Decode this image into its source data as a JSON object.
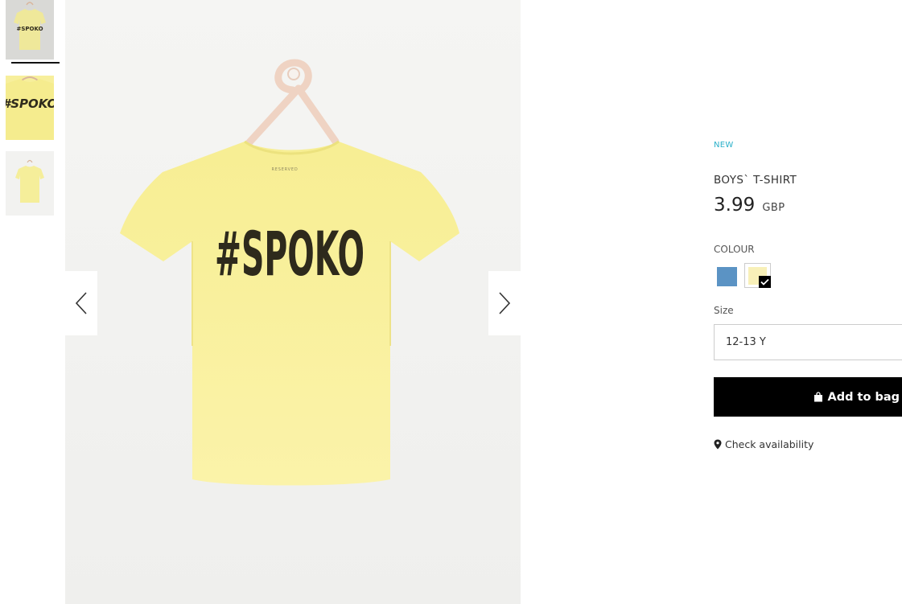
{
  "gallery": {
    "thumbnails": [
      {
        "name": "thumbnail-front",
        "print": "#SPOKO"
      },
      {
        "name": "thumbnail-closeup",
        "print": "#SPOKO"
      },
      {
        "name": "thumbnail-back",
        "print": ""
      }
    ],
    "main_print": "#SPOKO",
    "neck_label": "RESERVED"
  },
  "product": {
    "badge": "NEW",
    "title": "BOYS` T-SHIRT",
    "price": "3.99",
    "currency": "GBP",
    "colour_label": "COLOUR",
    "colours": [
      {
        "name": "blue",
        "hex": "#5b93c4",
        "selected": false
      },
      {
        "name": "yellow",
        "hex": "#f8f0b8",
        "selected": true
      }
    ],
    "size_label": "Size",
    "size_value": "12-13 Y",
    "add_to_bag": "Add to bag",
    "check_availability": "Check availability"
  },
  "colors": {
    "accent": "#2ab0c9",
    "shirt": "#f8f09c",
    "print": "#2e2a1c",
    "button": "#000000"
  },
  "icons": {
    "prev": "chevron-left-icon",
    "next": "chevron-right-icon",
    "bag": "shopping-bag-icon",
    "pin": "map-pin-icon",
    "check": "checkmark-icon"
  }
}
